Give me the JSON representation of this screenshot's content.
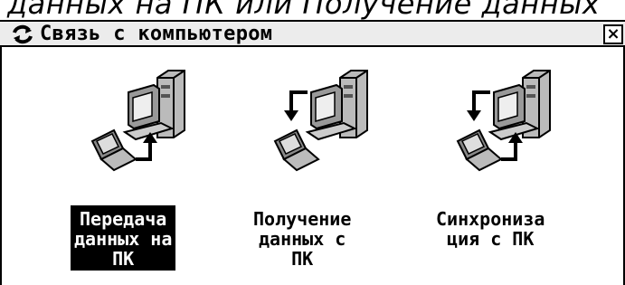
{
  "caption_top": "данных на ПК или Получение данных",
  "window": {
    "title": "Связь с компьютером",
    "close_label": "×"
  },
  "actions": [
    {
      "label": "Передача\nданных на\nПК",
      "icon": "pc-send-icon",
      "selected": true
    },
    {
      "label": "Получение\nданных с\nПК",
      "icon": "pc-receive-icon",
      "selected": false
    },
    {
      "label": "Синхрониза\nция с ПК",
      "icon": "pc-sync-icon",
      "selected": false
    }
  ]
}
